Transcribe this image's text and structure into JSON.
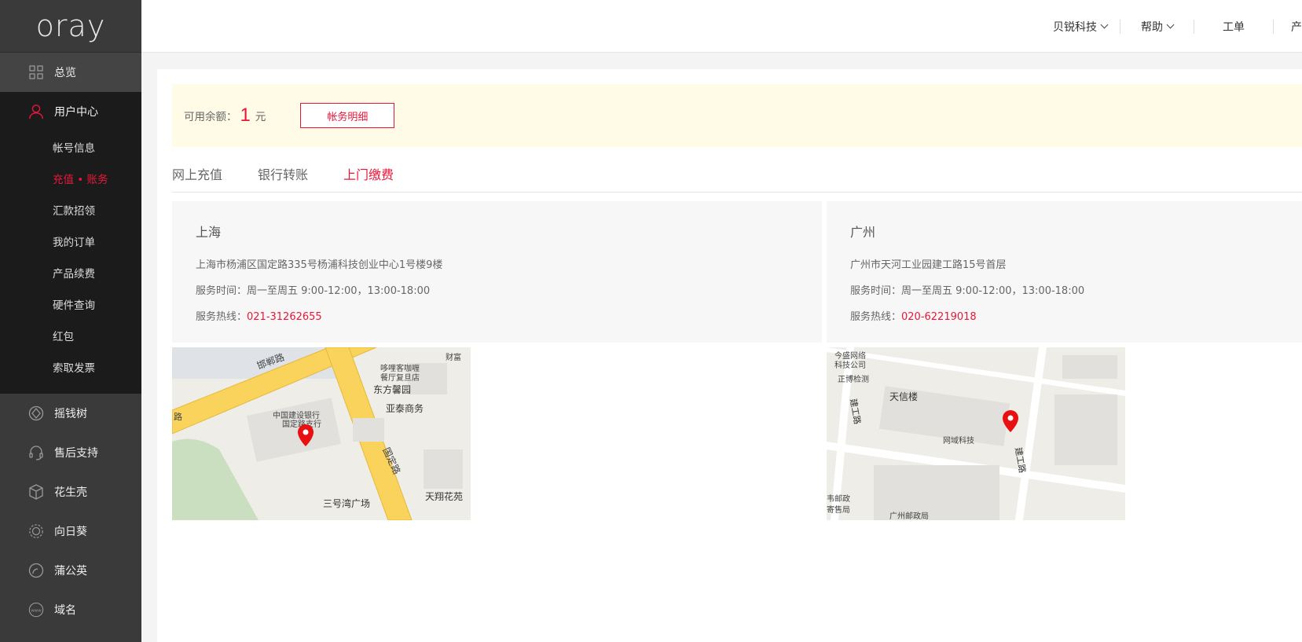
{
  "sidebar": {
    "logo": "oray",
    "overview": "总览",
    "user_center": {
      "label": "用户中心",
      "items": [
        {
          "label": "帐号信息",
          "active": false
        },
        {
          "label": "充值 • 账务",
          "active": true
        },
        {
          "label": "汇款招领",
          "active": false
        },
        {
          "label": "我的订单",
          "active": false
        },
        {
          "label": "产品续费",
          "active": false
        },
        {
          "label": "硬件查询",
          "active": false
        },
        {
          "label": "红包",
          "active": false
        },
        {
          "label": "索取发票",
          "active": false
        }
      ]
    },
    "products": [
      {
        "label": "摇钱树",
        "icon": "tree-icon"
      },
      {
        "label": "售后支持",
        "icon": "headset-icon"
      },
      {
        "label": "花生壳",
        "icon": "peanut-shell-icon"
      },
      {
        "label": "向日葵",
        "icon": "sunflower-icon"
      },
      {
        "label": "蒲公英",
        "icon": "dandelion-icon"
      },
      {
        "label": "域名",
        "icon": "www-icon"
      }
    ]
  },
  "topbar": {
    "company": "贝锐科技",
    "help": "帮助",
    "ticket": "工单",
    "cut_off": "产"
  },
  "balance": {
    "label": "可用余额：",
    "amount": "1",
    "unit": "元",
    "detail_button": "帐务明细"
  },
  "tabs": [
    {
      "label": "网上充值",
      "active": false
    },
    {
      "label": "银行转账",
      "active": false
    },
    {
      "label": "上门缴费",
      "active": true
    }
  ],
  "offices": {
    "shanghai": {
      "city": "上海",
      "address": "上海市杨浦区国定路335号杨浦科技创业中心1号楼9楼",
      "hours_label": "服务时间：",
      "hours": "周一至周五 9:00-12:00，13:00-18:00",
      "hotline_label": "服务热线：",
      "hotline": "021-31262655"
    },
    "guangzhou": {
      "city": "广州",
      "address": "广州市天河工业园建工路15号首层",
      "hours_label": "服务时间：",
      "hours": "周一至周五 9:00-12:00，13:00-18:00",
      "hotline_label": "服务热线：",
      "hotline": "020-62219018"
    }
  },
  "maps": {
    "shanghai": {
      "labels": {
        "road1": "邯郸路",
        "road2": "国定路",
        "poi1": "哆哩客咖喱",
        "poi1b": "餐厅复旦店",
        "poi2": "东方馨园",
        "poi3": "亚泰商务",
        "poi4": "中国建设银行",
        "poi4b": "国定路支行",
        "poi5": "三号湾广场",
        "poi6": "天翔花苑",
        "poi7": "财富",
        "road3": "路"
      }
    },
    "guangzhou": {
      "labels": {
        "poi1": "今盛网络",
        "poi1b": "科技公司",
        "poi2": "正博检测",
        "poi3": "天信楼",
        "poi4": "网域科技",
        "road1": "建工路",
        "road2": "建工路",
        "poi5": "韦邮政",
        "poi5b": "寄售局",
        "poi6": "广州邮政局"
      }
    }
  },
  "colors": {
    "accent": "#e8173a",
    "sidebar_bg": "#3a3a3a",
    "sidebar_group_bg": "#1b1b1b",
    "balance_bg": "#fffbe6"
  }
}
